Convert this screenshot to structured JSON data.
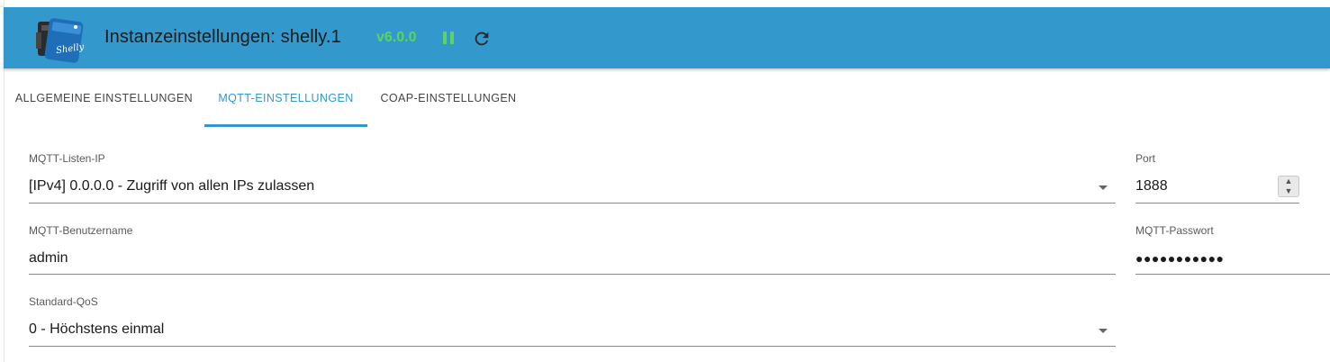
{
  "header": {
    "title": "Instanzeinstellungen: shelly.1",
    "version": "v6.0.0",
    "logo_text": "Shelly",
    "colors": {
      "bar": "#3399cc",
      "version": "#5dd45d",
      "pause": "#5dd45d"
    },
    "icons": {
      "pause": "pause-icon",
      "reload": "reload-icon"
    }
  },
  "tabs": [
    {
      "label": "ALLGEMEINE EINSTELLUNGEN",
      "active": false
    },
    {
      "label": "MQTT-EINSTELLUNGEN",
      "active": true
    },
    {
      "label": "COAP-EINSTELLUNGEN",
      "active": false
    }
  ],
  "form": {
    "listen_ip": {
      "label": "MQTT-Listen-IP",
      "value": "[IPv4] 0.0.0.0 - Zugriff von allen IPs zulassen"
    },
    "port": {
      "label": "Port",
      "value": "1888"
    },
    "username": {
      "label": "MQTT-Benutzername",
      "value": "admin"
    },
    "password": {
      "label": "MQTT-Passwort",
      "value": "●●●●●●●●●●●"
    },
    "qos": {
      "label": "Standard-QoS",
      "value": "0 - Höchstens einmal"
    }
  },
  "accent_color": "#3399cc"
}
